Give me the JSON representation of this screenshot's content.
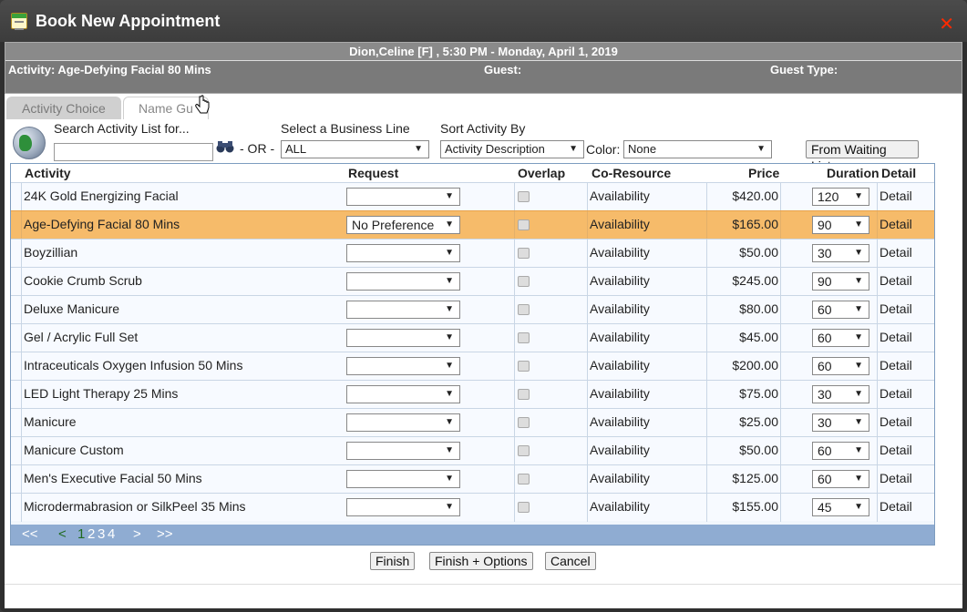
{
  "window": {
    "title": "Book New Appointment",
    "close_glyph": "✕"
  },
  "info": {
    "guest_line": "Dion,Celine [F] , 5:30 PM - Monday, April 1, 2019",
    "activity": "Activity: Age-Defying Facial 80 Mins",
    "guest": "Guest:",
    "guest_type": "Guest Type:"
  },
  "tabs": [
    {
      "label": "Activity Choice"
    },
    {
      "label": "Name Gu"
    }
  ],
  "filters": {
    "search_label": "Search Activity List for...",
    "or_label": "- OR -",
    "business_line_label": "Select a Business Line",
    "business_line_value": "ALL",
    "sort_label": "Sort Activity By",
    "sort_value": "Activity Description",
    "color_label": "Color:",
    "color_value": "None",
    "waiting_list_button": "From Waiting List..."
  },
  "table": {
    "headers": {
      "activity": "Activity",
      "request": "Request",
      "overlap": "Overlap",
      "coresource": "Co-Resource",
      "price": "Price",
      "duration": "Duration",
      "detail": "Detail"
    },
    "rows": [
      {
        "activity": "24K Gold Energizing Facial",
        "request": "",
        "coresource": "Availability",
        "price": "$420.00",
        "duration": "120",
        "detail": "Detail"
      },
      {
        "activity": "Age-Defying Facial 80 Mins",
        "request": "No Preference",
        "coresource": "Availability",
        "price": "$165.00",
        "duration": "90",
        "detail": "Detail"
      },
      {
        "activity": "Boyzillian",
        "request": "",
        "coresource": "Availability",
        "price": "$50.00",
        "duration": "30",
        "detail": "Detail"
      },
      {
        "activity": "Cookie Crumb Scrub",
        "request": "",
        "coresource": "Availability",
        "price": "$245.00",
        "duration": "90",
        "detail": "Detail"
      },
      {
        "activity": "Deluxe Manicure",
        "request": "",
        "coresource": "Availability",
        "price": "$80.00",
        "duration": "60",
        "detail": "Detail"
      },
      {
        "activity": "Gel / Acrylic Full Set",
        "request": "",
        "coresource": "Availability",
        "price": "$45.00",
        "duration": "60",
        "detail": "Detail"
      },
      {
        "activity": "Intraceuticals Oxygen Infusion 50 Mins",
        "request": "",
        "coresource": "Availability",
        "price": "$200.00",
        "duration": "60",
        "detail": "Detail"
      },
      {
        "activity": "LED Light Therapy 25 Mins",
        "request": "",
        "coresource": "Availability",
        "price": "$75.00",
        "duration": "30",
        "detail": "Detail"
      },
      {
        "activity": "Manicure",
        "request": "",
        "coresource": "Availability",
        "price": "$25.00",
        "duration": "30",
        "detail": "Detail"
      },
      {
        "activity": "Manicure Custom",
        "request": "",
        "coresource": "Availability",
        "price": "$50.00",
        "duration": "60",
        "detail": "Detail"
      },
      {
        "activity": "Men's Executive Facial 50 Mins",
        "request": "",
        "coresource": "Availability",
        "price": "$125.00",
        "duration": "60",
        "detail": "Detail"
      },
      {
        "activity": "Microdermabrasion or SilkPeel 35 Mins",
        "request": "",
        "coresource": "Availability",
        "price": "$155.00",
        "duration": "45",
        "detail": "Detail"
      }
    ],
    "selected_index": 1,
    "pager": {
      "first": "<<",
      "prev": "<",
      "current": "1",
      "pages": [
        "2",
        "3",
        "4"
      ],
      "next": ">",
      "last": ">>"
    }
  },
  "actions": {
    "finish": "Finish",
    "finish_options": "Finish + Options",
    "cancel": "Cancel"
  },
  "colors": {
    "titlebar": "#3f3f3f",
    "info_panel": "#7a7a7a",
    "selected_row": "#f6bb6a",
    "pager": "#8facd2",
    "close": "#ff2a00"
  }
}
